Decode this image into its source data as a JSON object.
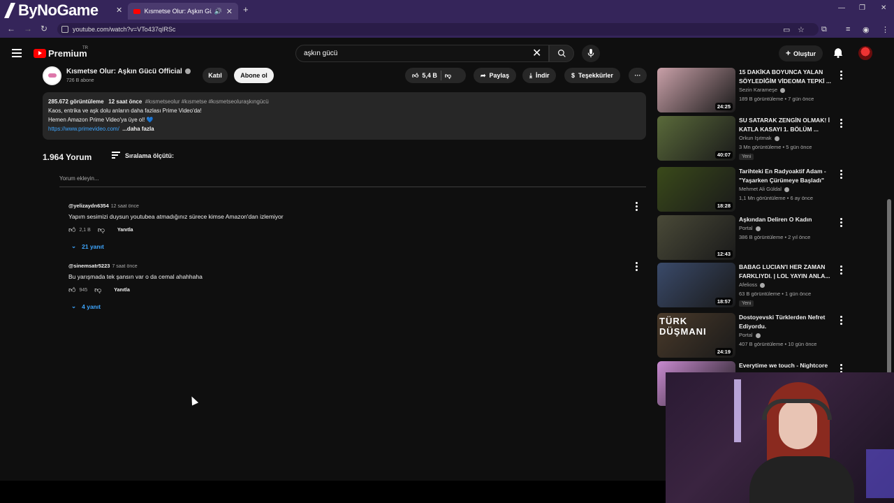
{
  "browser": {
    "overlay_brand": "ByNoGame",
    "tabs": [
      {
        "label": "Kısmetse Olur: Aşkın Gücü"
      }
    ],
    "url": "youtube.com/watch?v=VTo437qIRSc"
  },
  "header": {
    "logo_text": "Premium",
    "region": "TR",
    "search_value": "aşkın gücü",
    "create_label": "Oluştur"
  },
  "channel": {
    "name": "Kısmetse Olur: Aşkın Gücü Official",
    "subscribers": "726 B abone",
    "join_label": "Katıl",
    "subscribe_label": "Abone ol"
  },
  "actions": {
    "likes": "5,4 B",
    "share": "Paylaş",
    "download": "İndir",
    "thanks": "Teşekkürler"
  },
  "description": {
    "views": "285.672 görüntüleme",
    "age": "12 saat önce",
    "tags": "#kısmetseolur #kısmetse #kısmetseoluraşkıngücü",
    "line1": "Kaos, entrika ve aşk dolu anların daha fazlası Prime Video'da!",
    "line2": "Hemen Amazon Prime Video'ya üye ol! 💙",
    "link": "https://www.primevideo.com/",
    "more": "...daha fazla"
  },
  "comments": {
    "count": "1.964 Yorum",
    "sort_label": "Sıralama ölçütü:",
    "add_placeholder": "Yorum ekleyin...",
    "reply_label": "Yanıtla",
    "items": [
      {
        "author": "@yelizaydn6354",
        "time": "12 saat önce",
        "text": "Yapım sesimizi duysun youtubea atmadığınız sürece kimse Amazon'dan izlemiyor",
        "likes": "2,1 B",
        "replies": "21 yanıt"
      },
      {
        "author": "@sinemsatr5223",
        "time": "7 saat önce",
        "text": "Bu yarışmada tek şansın var o da cemal ahahhaha",
        "likes": "945",
        "replies": "4 yanıt"
      }
    ]
  },
  "recommendations": [
    {
      "title": "15 DAKİKA BOYUNCA YALAN SÖYLEDİĞİM VİDEOMA TEPKİ ...",
      "channel": "Sezin Karameşe",
      "meta": "189 B görüntüleme • 7 gün önce",
      "duration": "24:25",
      "badge": "",
      "color": "#c9a0a8"
    },
    {
      "title": "SU SATARAK ZENGİN OLMAK! İ KATLA KASAYI 1. BÖLÜM ...",
      "channel": "Orkun Işıtmak",
      "meta": "3 Mn görüntüleme • 5 gün önce",
      "duration": "40:07",
      "badge": "Yeni",
      "color": "#5a6a3a"
    },
    {
      "title": "Tarihteki En Radyoaktif Adam - \"Yaşarken Çürümeye Başladı\"",
      "channel": "Mehmet Ali Güldal",
      "meta": "1,1 Mn görüntüleme • 6 ay önce",
      "duration": "18:28",
      "badge": "",
      "color": "#3a4a1a"
    },
    {
      "title": "Aşkından Deliren O Kadın",
      "channel": "Portal",
      "meta": "386 B görüntüleme • 2 yıl önce",
      "duration": "12:43",
      "badge": "",
      "color": "#4a4a38"
    },
    {
      "title": "BABAG LUCIAN'I HER ZAMAN FARKLIYDI. | LOL YAYIN ANLA...",
      "channel": "Afelioss",
      "meta": "63 B görüntüleme • 1 gün önce",
      "duration": "18:57",
      "badge": "Yeni",
      "color": "#3a4a6a"
    },
    {
      "title": "Dostoyevski Türklerden Nefret Ediyordu.",
      "channel": "Portal",
      "meta": "407 B görüntüleme • 10 gün önce",
      "duration": "24:19",
      "badge": "",
      "color": "#4a3a2a",
      "thumb_text": "TÜRK DÜŞMANI"
    },
    {
      "title": "Everytime we touch - Nightcore",
      "channel": "",
      "meta": "",
      "duration": "",
      "badge": "",
      "color": "#c88ad0"
    }
  ]
}
